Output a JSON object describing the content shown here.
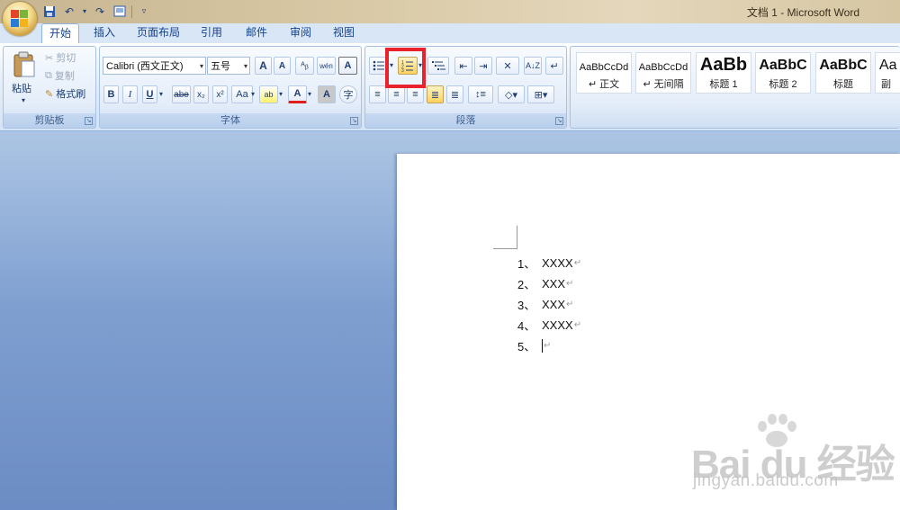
{
  "window": {
    "title": "文档 1 - Microsoft Word"
  },
  "tabs": [
    {
      "label": "开始"
    },
    {
      "label": "插入"
    },
    {
      "label": "页面布局"
    },
    {
      "label": "引用"
    },
    {
      "label": "邮件"
    },
    {
      "label": "审阅"
    },
    {
      "label": "视图"
    }
  ],
  "clipboard": {
    "paste_label": "粘贴",
    "cut_label": "剪切",
    "copy_label": "复制",
    "format_painter_label": "格式刷",
    "group_label": "剪贴板"
  },
  "font": {
    "font_name": "Calibri (西文正文)",
    "font_size": "五号",
    "group_label": "字体",
    "grow_label": "A",
    "shrink_label": "A",
    "wen_label": "wén",
    "char_border_label": "A",
    "bold_label": "B",
    "italic_label": "I",
    "underline_label": "U",
    "strike_label": "abe",
    "subscript_label": "x₂",
    "superscript_label": "x²",
    "case_label": "Aa",
    "highlight_label": "ab",
    "font_color_label": "A",
    "char_shading_label": "A",
    "enclose_label": "字"
  },
  "paragraph": {
    "group_label": "段落"
  },
  "styles": [
    {
      "sample": "AaBbCcDd",
      "name": "↵ 正文"
    },
    {
      "sample": "AaBbCcDd",
      "name": "↵ 无间隔"
    },
    {
      "sample": "AaBb",
      "name": "标题 1"
    },
    {
      "sample": "AaBbC",
      "name": "标题 2"
    },
    {
      "sample": "AaBbC",
      "name": "标题"
    },
    {
      "sample": "Aa",
      "name": "副"
    }
  ],
  "document": {
    "list": [
      {
        "num": "1、",
        "text": "XXXX"
      },
      {
        "num": "2、",
        "text": "XXX"
      },
      {
        "num": "3、",
        "text": "XXX"
      },
      {
        "num": "4、",
        "text": "XXXX"
      },
      {
        "num": "5、",
        "text": ""
      }
    ],
    "para_mark": "↵"
  },
  "watermark": {
    "logo_text": "Bai du 经验",
    "url_text": "jingyan.baidu.com"
  }
}
